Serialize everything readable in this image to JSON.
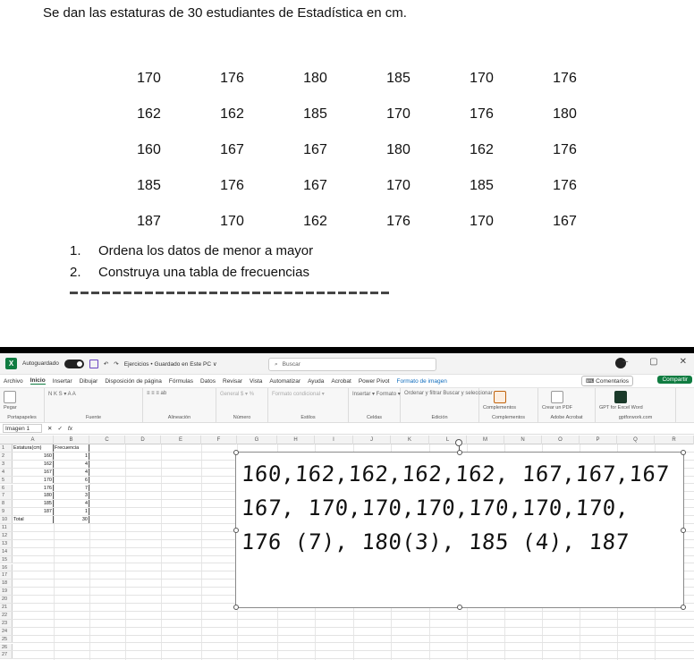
{
  "document": {
    "problem": "Se dan las estaturas de 30 estudiantes de Estadística en cm.",
    "table": [
      [
        "170",
        "176",
        "180",
        "185",
        "170",
        "176"
      ],
      [
        "162",
        "162",
        "185",
        "170",
        "176",
        "180"
      ],
      [
        "160",
        "167",
        "167",
        "180",
        "162",
        "176"
      ],
      [
        "185",
        "176",
        "167",
        "170",
        "185",
        "176"
      ],
      [
        "187",
        "170",
        "162",
        "176",
        "170",
        "167"
      ]
    ],
    "tasks": [
      {
        "num": "1.",
        "text": "Ordena los datos de menor a mayor"
      },
      {
        "num": "2.",
        "text": "Construya una tabla de frecuencias"
      }
    ]
  },
  "excel": {
    "titlebar": {
      "autosave": "Autoguardado",
      "file_title": "Ejercicios • Guardado en Este PC ∨",
      "search_placeholder": "Buscar",
      "minimize": "–",
      "maximize": "▢",
      "close": "✕"
    },
    "menu": [
      "Archivo",
      "Inicio",
      "Insertar",
      "Dibujar",
      "Disposición de página",
      "Fórmulas",
      "Datos",
      "Revisar",
      "Vista",
      "Automatizar",
      "Ayuda",
      "Acrobat",
      "Power Pivot",
      "Formato de imagen"
    ],
    "active_menu": "Inicio",
    "comments": "Comentarios",
    "share": "Compartir",
    "ribbon_groups": [
      {
        "label": "Portapapeles",
        "body": "Pegar"
      },
      {
        "label": "Fuente",
        "body": "N K S ▾ A A"
      },
      {
        "label": "Alineación",
        "body": "≡ ≡ ≡ ab"
      },
      {
        "label": "Número",
        "body": "General $ ▾ %"
      },
      {
        "label": "Estilos",
        "body": "Formato condicional ▾"
      },
      {
        "label": "Celdas",
        "body": "Insertar ▾ Formato ▾"
      },
      {
        "label": "Edición",
        "body": "Ordenar y filtrar  Buscar y seleccionar"
      },
      {
        "label": "Complementos",
        "body": "Complementos"
      },
      {
        "label": "Adobe Acrobat",
        "body": "Crear un PDF"
      },
      {
        "label": "gptforwork.com",
        "body": "GPT for Excel Word"
      }
    ],
    "namebox": "Imagen 1",
    "fx": "fx",
    "columns": [
      "A",
      "B",
      "C",
      "D",
      "E",
      "F",
      "G",
      "H",
      "I",
      "J",
      "K",
      "L",
      "M",
      "N",
      "O",
      "P",
      "Q",
      "R"
    ],
    "headers": [
      "Estatura(cm)",
      "Frecuencia"
    ],
    "rows": [
      {
        "a": "160",
        "b": "1"
      },
      {
        "a": "162",
        "b": "4"
      },
      {
        "a": "167",
        "b": "4"
      },
      {
        "a": "170",
        "b": "6"
      },
      {
        "a": "176",
        "b": "7"
      },
      {
        "a": "180",
        "b": "3"
      },
      {
        "a": "185",
        "b": "4"
      },
      {
        "a": "187",
        "b": "1"
      }
    ],
    "total_label": "Total",
    "total_value": "30",
    "handwriting": [
      "160,162,162,162,162, 167,167,167",
      "167, 170,170,170,170,170,170,",
      "176 (7), 180(3), 185 (4), 187"
    ]
  }
}
